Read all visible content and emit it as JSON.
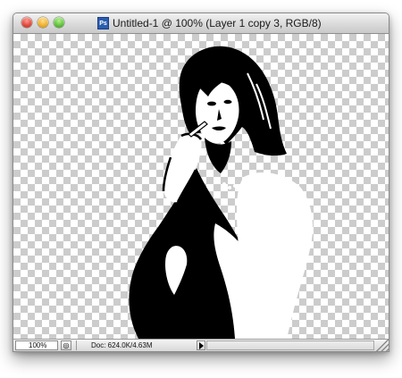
{
  "window": {
    "title": "Untitled-1 @ 100% (Layer 1 copy 3, RGB/8)",
    "doc_icon_label": "Ps"
  },
  "canvas": {
    "content": "black-and-white threshold portrait on transparent checkerboard",
    "checker_color_1": "#cccccc",
    "checker_color_2": "#ffffff"
  },
  "statusbar": {
    "zoom": "100%",
    "doc_info": "Doc: 624.0K/4.63M"
  },
  "icons": {
    "close": "close-icon",
    "minimize": "minimize-icon",
    "zoom": "zoom-icon",
    "document": "photoshop-document-icon",
    "status_menu": "status-menu-icon",
    "info_arrow": "triangle-right-icon",
    "resize": "resize-grip-icon"
  }
}
